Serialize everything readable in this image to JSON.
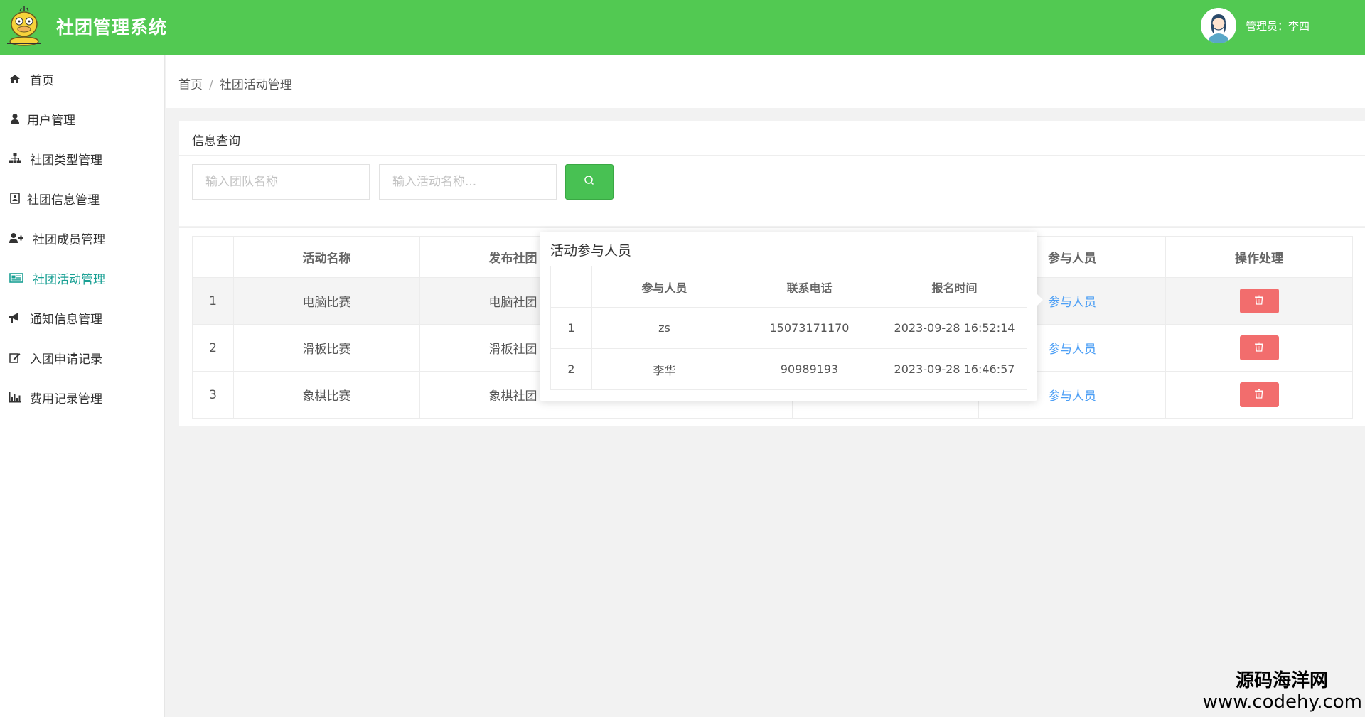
{
  "header": {
    "title": "社团管理系统",
    "admin_label": "管理员：李四"
  },
  "sidebar": {
    "items": [
      {
        "label": "首页",
        "icon": "home-icon"
      },
      {
        "label": "用户管理",
        "icon": "user-icon"
      },
      {
        "label": "社团类型管理",
        "icon": "sitemap-icon"
      },
      {
        "label": "社团信息管理",
        "icon": "id-card-icon"
      },
      {
        "label": "社团成员管理",
        "icon": "user-plus-icon"
      },
      {
        "label": "社团活动管理",
        "icon": "newspaper-icon",
        "active": true
      },
      {
        "label": "通知信息管理",
        "icon": "bullhorn-icon"
      },
      {
        "label": "入团申请记录",
        "icon": "edit-icon"
      },
      {
        "label": "费用记录管理",
        "icon": "bar-chart-icon"
      }
    ]
  },
  "breadcrumb": {
    "home": "首页",
    "separator": "/",
    "current": "社团活动管理"
  },
  "query": {
    "title": "信息查询",
    "team_placeholder": "输入团队名称",
    "activity_placeholder": "输入活动名称..."
  },
  "table": {
    "headers": [
      "",
      "活动名称",
      "发布社团",
      "",
      "",
      "参与人员",
      "操作处理"
    ],
    "rows": [
      {
        "index": "1",
        "name": "电脑比赛",
        "club": "电脑社团",
        "participants_link": "参与人员"
      },
      {
        "index": "2",
        "name": "滑板比赛",
        "club": "滑板社团",
        "participants_link": "参与人员"
      },
      {
        "index": "3",
        "name": "象棋比赛",
        "club": "象棋社团",
        "participants_link": "参与人员"
      }
    ]
  },
  "popover": {
    "title": "活动参与人员",
    "headers": [
      "",
      "参与人员",
      "联系电话",
      "报名时间"
    ],
    "rows": [
      {
        "index": "1",
        "name": "zs",
        "phone": "15073171170",
        "time": "2023-09-28 16:52:14"
      },
      {
        "index": "2",
        "name": "李华",
        "phone": "90989193",
        "time": "2023-09-28 16:46:57"
      }
    ]
  },
  "watermark": {
    "name": "源码海洋网",
    "url": "www.codehy.com"
  },
  "colors": {
    "header": "#52c952",
    "active_nav": "#1aa094",
    "link": "#4b9ef5",
    "delete": "#f26d6d",
    "search": "#48c153"
  }
}
